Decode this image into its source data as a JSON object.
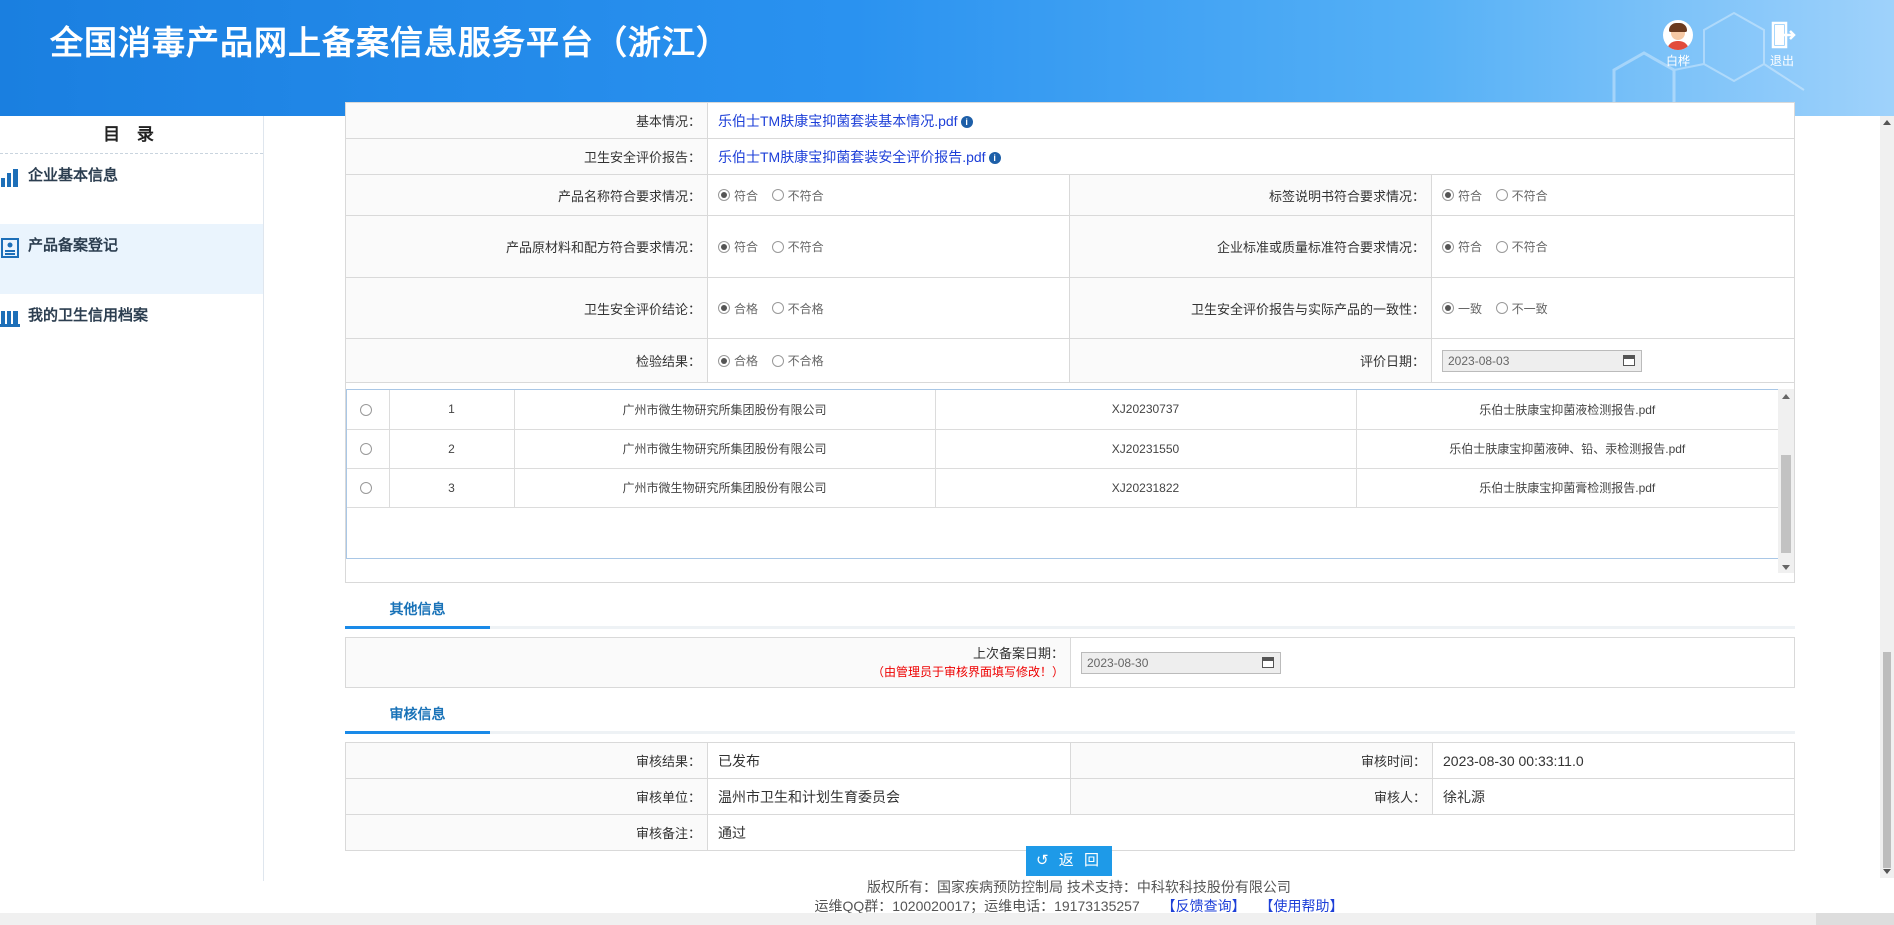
{
  "header": {
    "title": "全国消毒产品网上备案信息服务平台（浙江）",
    "user_label": "白桦",
    "logout_label": "退出"
  },
  "sidebar": {
    "title": "目 录",
    "items": [
      {
        "label": "企业基本信息",
        "icon": "building-chart-icon"
      },
      {
        "label": "产品备案登记",
        "icon": "id-card-icon"
      },
      {
        "label": "我的卫生信用档案",
        "icon": "archive-icon"
      }
    ]
  },
  "form": {
    "basic_label": "基本情况：",
    "basic_file": "乐伯士TM肤康宝抑菌套装基本情况.pdf",
    "safety_label": "卫生安全评价报告：",
    "safety_file": "乐伯士TM肤康宝抑菌套装安全评价报告.pdf",
    "name_req_label": "产品名称符合要求情况：",
    "label_req_label": "标签说明书符合要求情况：",
    "material_label": "产品原材料和配方符合要求情况：",
    "standard_label": "企业标准或质量标准符合要求情况：",
    "conclusion_label": "卫生安全评价结论：",
    "consistency_label": "卫生安全评价报告与实际产品的一致性：",
    "inspect_label": "检验结果：",
    "eval_date_label": "评价日期：",
    "eval_date": "2023-08-03",
    "opt_comply": "符合",
    "opt_noncomply": "不符合",
    "opt_pass": "合格",
    "opt_fail": "不合格",
    "opt_consistent": "一致",
    "opt_inconsistent": "不一致"
  },
  "reports": [
    {
      "no": "1",
      "org": "广州市微生物研究所集团股份有限公司",
      "code": "XJ20230737",
      "file": "乐伯士肤康宝抑菌液检测报告.pdf"
    },
    {
      "no": "2",
      "org": "广州市微生物研究所集团股份有限公司",
      "code": "XJ20231550",
      "file": "乐伯士肤康宝抑菌液砷、铅、汞检测报告.pdf"
    },
    {
      "no": "3",
      "org": "广州市微生物研究所集团股份有限公司",
      "code": "XJ20231822",
      "file": "乐伯士肤康宝抑菌膏检测报告.pdf"
    }
  ],
  "other": {
    "section_title": "其他信息",
    "last_date_label": "上次备案日期：",
    "last_date_note": "（由管理员于审核界面填写修改！）",
    "last_date": "2023-08-30"
  },
  "review": {
    "section_title": "审核信息",
    "result_label": "审核结果：",
    "result": "已发布",
    "time_label": "审核时间：",
    "time": "2023-08-30 00:33:11.0",
    "unit_label": "审核单位：",
    "unit": "温州市卫生和计划生育委员会",
    "reviewer_label": "审核人：",
    "reviewer": "徐礼源",
    "remark_label": "审核备注：",
    "remark": "通过"
  },
  "back_button": "返 回",
  "footer": {
    "line1": "版权所有：国家疾病预防控制局  技术支持：中科软科技股份有限公司",
    "line2": "运维QQ群：1020020017；运维电话：19173135257",
    "feedback": "【反馈查询】",
    "help": "【使用帮助】"
  },
  "colors": {
    "header_blue": "#1a7fe0",
    "link_blue": "#1d3fd8",
    "accent": "#1e9ae8",
    "note_red": "#ee0000"
  }
}
